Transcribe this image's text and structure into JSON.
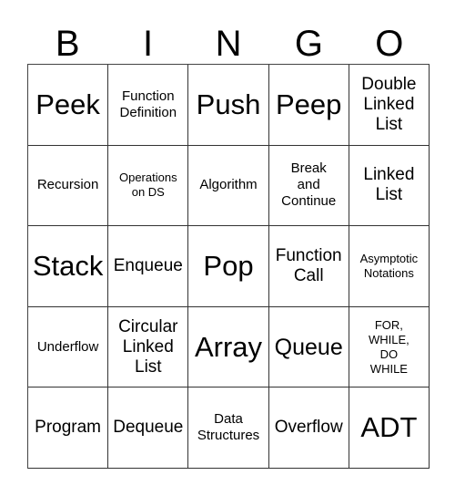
{
  "card": {
    "title_letters": [
      "B",
      "I",
      "N",
      "G",
      "O"
    ],
    "columns": 5,
    "rows": 5,
    "colors": {
      "background": "#ffffff",
      "text": "#000000",
      "grid_line": "#333333"
    },
    "cells": [
      {
        "text": "Peek",
        "size": "xl"
      },
      {
        "text": "Function\nDefinition",
        "size": "sm"
      },
      {
        "text": "Push",
        "size": "xl"
      },
      {
        "text": "Peep",
        "size": "xl"
      },
      {
        "text": "Double\nLinked\nList",
        "size": "md"
      },
      {
        "text": "Recursion",
        "size": "sm"
      },
      {
        "text": "Operations\non DS",
        "size": "xs"
      },
      {
        "text": "Algorithm",
        "size": "sm"
      },
      {
        "text": "Break\nand\nContinue",
        "size": "sm"
      },
      {
        "text": "Linked\nList",
        "size": "md"
      },
      {
        "text": "Stack",
        "size": "xl"
      },
      {
        "text": "Enqueue",
        "size": "md"
      },
      {
        "text": "Pop",
        "size": "xl"
      },
      {
        "text": "Function\nCall",
        "size": "md"
      },
      {
        "text": "Asymptotic\nNotations",
        "size": "xs"
      },
      {
        "text": "Underflow",
        "size": "sm"
      },
      {
        "text": "Circular\nLinked\nList",
        "size": "md"
      },
      {
        "text": "Array",
        "size": "xl"
      },
      {
        "text": "Queue",
        "size": "lg"
      },
      {
        "text": "FOR,\nWHILE,\nDO\nWHILE",
        "size": "xs"
      },
      {
        "text": "Program",
        "size": "md"
      },
      {
        "text": "Dequeue",
        "size": "md"
      },
      {
        "text": "Data\nStructures",
        "size": "sm"
      },
      {
        "text": "Overflow",
        "size": "md"
      },
      {
        "text": "ADT",
        "size": "xl"
      }
    ]
  }
}
